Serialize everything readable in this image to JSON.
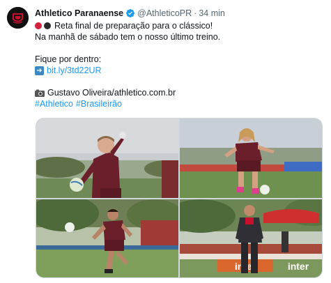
{
  "tweet": {
    "author_name": "Athletico Paranaense",
    "handle": "@AthleticoPR",
    "separator": "·",
    "time": "34 min",
    "line1": "Reta final de preparação para o clássico!",
    "line2": "Na manhã de sábado tem o nosso último treino.",
    "line3": "Fique por dentro:",
    "link": "bit.ly/3td22UR",
    "credit": "Gustavo Oliveira/athletico.com.br",
    "hashtag1": "#Athletico",
    "hashtag2": "#Brasileirão"
  },
  "colors": {
    "link": "#1d9bf0",
    "verified": "#1d9bf0",
    "club_red": "#d4213d",
    "club_black": "#2b2b2b"
  },
  "icons": {
    "avatar": "athletico-crest-icon",
    "verified": "verified-badge-icon",
    "link_arrow": "right-arrow-emoji-icon",
    "credit": "camera-emoji-icon"
  },
  "media": {
    "photos": [
      {
        "description_name": "goalkeeper-training-photo"
      },
      {
        "description_name": "player-long-hair-training-photo"
      },
      {
        "description_name": "player-striking-ball-photo"
      },
      {
        "description_name": "coach-walking-photo"
      }
    ],
    "sponsor_text": "inter"
  }
}
